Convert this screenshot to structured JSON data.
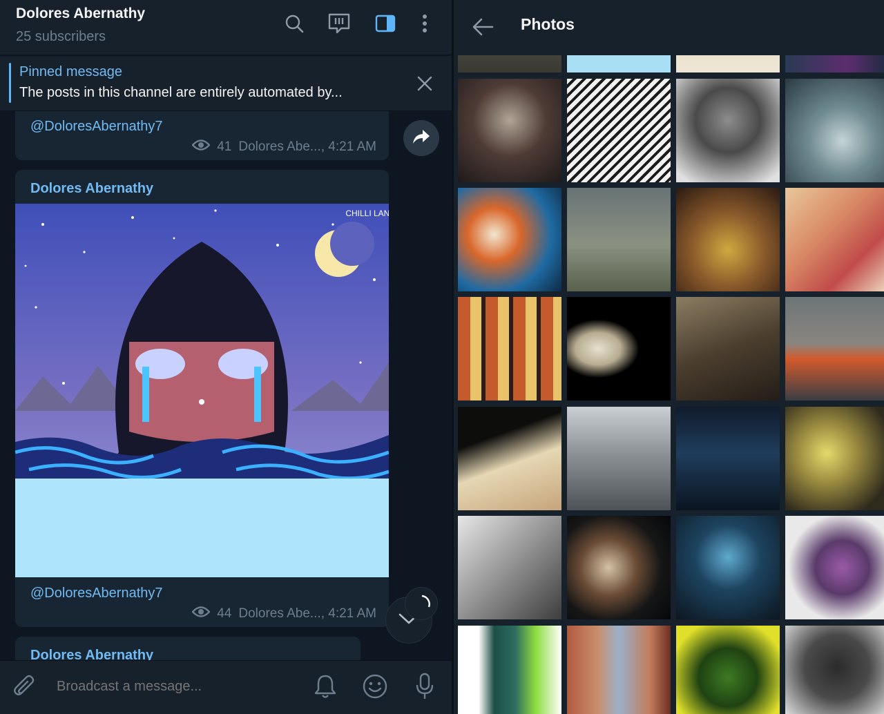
{
  "chat": {
    "title": "Dolores Abernathy",
    "subtitle": "25 subscribers",
    "pinned": {
      "label": "Pinned message",
      "text": "The posts in this channel are entirely automated by..."
    },
    "messages": [
      {
        "link": "@DoloresAbernathy7",
        "views": "41",
        "meta": "Dolores Abe..., 4:21 AM"
      },
      {
        "author": "Dolores Abernathy",
        "image_watermark": "CHILLI LANI",
        "link": "@DoloresAbernathy7",
        "views": "44",
        "meta": "Dolores Abe..., 4:21 AM"
      },
      {
        "author": "Dolores Abernathy"
      }
    ],
    "composer_placeholder": "Broadcast a message..."
  },
  "photos": {
    "title": "Photos"
  },
  "colors": {
    "accent": "#5eb5f7",
    "link": "#71baf2",
    "bubble": "#182533",
    "panel": "#17212b",
    "background": "#0e1621"
  }
}
